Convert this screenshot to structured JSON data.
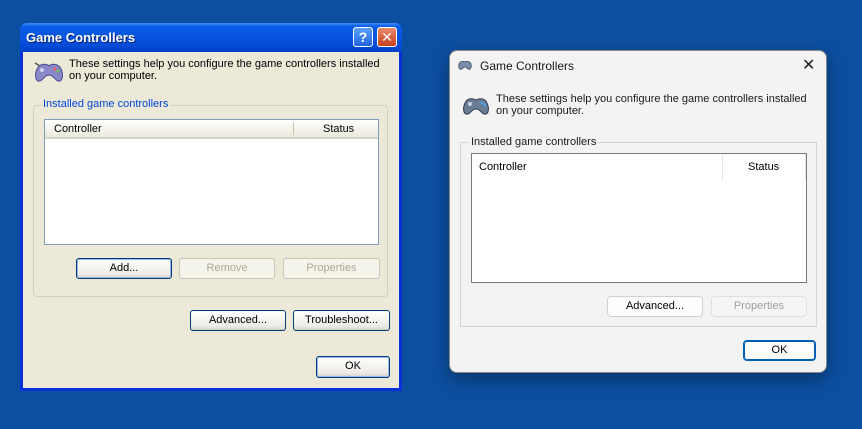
{
  "xp": {
    "title": "Game Controllers",
    "help_glyph": "?",
    "close_glyph": "✕",
    "description": "These settings help you configure the game controllers installed on your computer.",
    "group_label": "Installed game controllers",
    "columns": [
      "Controller",
      "Status"
    ],
    "buttons": {
      "add": "Add...",
      "remove": "Remove",
      "properties": "Properties",
      "advanced": "Advanced...",
      "troubleshoot": "Troubleshoot...",
      "ok": "OK"
    }
  },
  "win11": {
    "title": "Game Controllers",
    "close_glyph": "✕",
    "description": "These settings help you configure the game controllers installed on your computer.",
    "group_label": "Installed game controllers",
    "columns": [
      "Controller",
      "Status"
    ],
    "buttons": {
      "advanced": "Advanced...",
      "properties": "Properties",
      "ok": "OK"
    }
  },
  "colors": {
    "desktop": "#0c4fa0",
    "xp_titlebar": "#0654e0",
    "xp_face": "#ece9d8",
    "win11_face": "#f3f3f3",
    "win11_accent": "#005fb8"
  }
}
